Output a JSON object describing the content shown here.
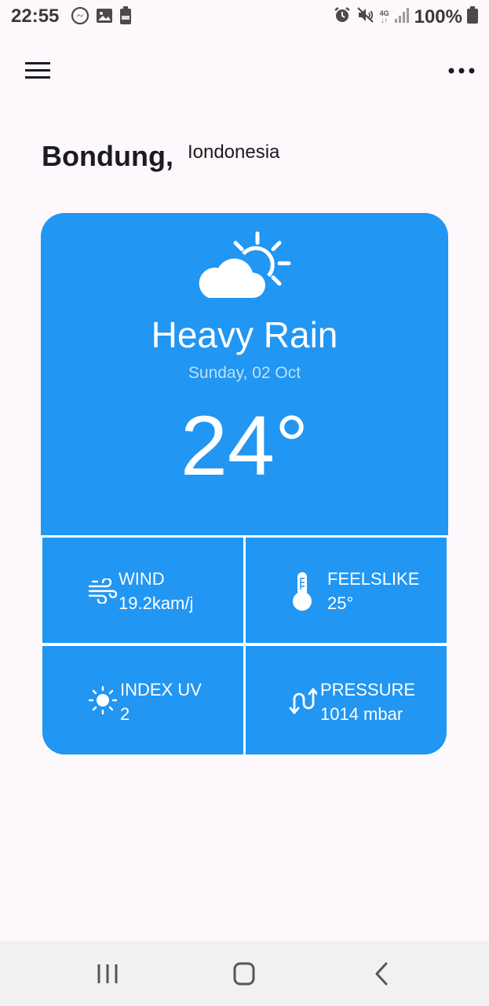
{
  "status_bar": {
    "time": "22:55",
    "network": "4G",
    "battery": "100%",
    "icons": [
      "messenger-icon",
      "gallery-icon",
      "battery-saver-icon",
      "alarm-icon",
      "mute-icon",
      "signal-icon",
      "battery-icon"
    ]
  },
  "app_bar": {
    "menu_icon": "hamburger-menu-icon",
    "more_icon": "more-horizontal-icon"
  },
  "location": {
    "city": "Bondung,",
    "country": "Iondonesia"
  },
  "current": {
    "icon": "partly-cloudy-icon",
    "condition": "Heavy Rain",
    "date": "Sunday, 02 Oct",
    "temperature": "24°"
  },
  "details": {
    "wind": {
      "label": "WIND",
      "value": "19.2kam/j",
      "icon": "wind-icon"
    },
    "feelslike": {
      "label": "FEELSLIKE",
      "value": "25°",
      "icon": "thermometer-icon"
    },
    "uv": {
      "label": "INDEX UV",
      "value": "2",
      "icon": "sun-icon"
    },
    "pressure": {
      "label": "PRESSURE",
      "value": "1014 mbar",
      "icon": "pressure-arrows-icon"
    }
  },
  "colors": {
    "card": "#2196f3",
    "background": "#fdf8fc",
    "date_text": "#bde0fb"
  }
}
